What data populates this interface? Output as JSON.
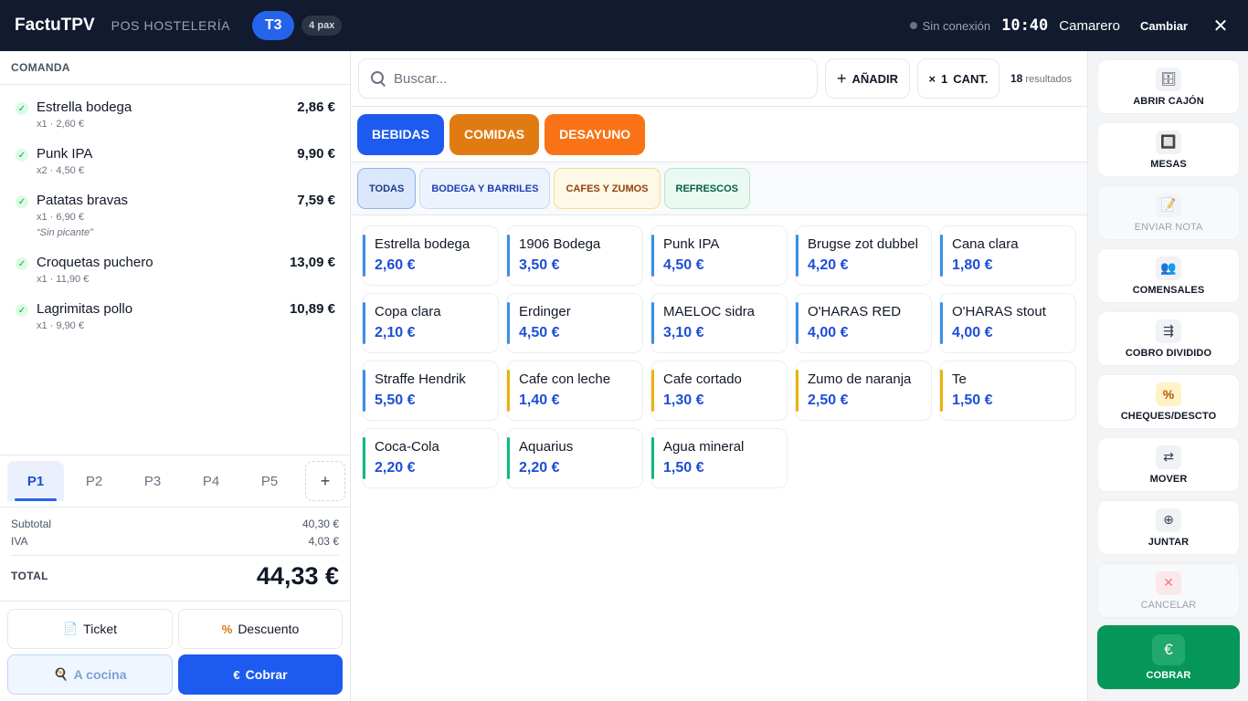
{
  "header": {
    "brand": "FactuTPV",
    "subtitle": "POS HOSTELERÍA",
    "table": "T3",
    "pax": "4 pax",
    "connection": "Sin conexión",
    "clock": "10:40",
    "waiter": "Camarero",
    "change": "Cambiar",
    "close": "✕"
  },
  "order": {
    "title": "COMANDA",
    "items": [
      {
        "name": "Estrella bodega",
        "total": "2,86 €",
        "meta": "x1 · 2,60 €",
        "note": ""
      },
      {
        "name": "Punk IPA",
        "total": "9,90 €",
        "meta": "x2 · 4,50 €",
        "note": ""
      },
      {
        "name": "Patatas bravas",
        "total": "7,59 €",
        "meta": "x1 · 6,90 €",
        "note": "“Sin picante”"
      },
      {
        "name": "Croquetas puchero",
        "total": "13,09 €",
        "meta": "x1 · 11,90 €",
        "note": ""
      },
      {
        "name": "Lagrimitas pollo",
        "total": "10,89 €",
        "meta": "x1 · 9,90 €",
        "note": ""
      }
    ]
  },
  "persons": [
    "P1",
    "P2",
    "P3",
    "P4",
    "P5"
  ],
  "persons_add": "+",
  "totals": {
    "subtotal_label": "Subtotal",
    "subtotal": "40,30 €",
    "tax_label": "IVA",
    "tax": "4,03 €",
    "total_label": "TOTAL",
    "total": "44,33 €"
  },
  "actions": {
    "ticket": "Ticket",
    "discount": "Descuento",
    "kitchen": "A cocina",
    "pay": "Cobrar",
    "pay_symbol": "€"
  },
  "search": {
    "placeholder": "Buscar...",
    "add": "AÑADIR",
    "qty_prefix": "×",
    "qty": "1",
    "qty_label": "CANT.",
    "results_count": "18",
    "results_label": "resultados"
  },
  "categories": [
    {
      "label": "BEBIDAS",
      "color": "#1d5bf0"
    },
    {
      "label": "COMIDAS",
      "color": "#e07b12"
    },
    {
      "label": "DESAYUNO",
      "color": "#f97316"
    }
  ],
  "subcategories": [
    {
      "label": "TODAS",
      "bg": "#dbe7fb",
      "border": "#8fb1ec",
      "text": "#1e3a8a"
    },
    {
      "label": "BODEGA Y BARRILES",
      "bg": "#edf3fd",
      "border": "#c9daf5",
      "text": "#1e40af"
    },
    {
      "label": "CAFES Y ZUMOS",
      "bg": "#fef8e6",
      "border": "#f4dc8f",
      "text": "#92400e"
    },
    {
      "label": "REFRESCOS",
      "bg": "#eaf9f2",
      "border": "#b5e6cd",
      "text": "#065f46"
    }
  ],
  "products": [
    {
      "name": "Estrella bodega",
      "price": "2,60 €",
      "color": "#3b8ee6"
    },
    {
      "name": "1906 Bodega",
      "price": "3,50 €",
      "color": "#3b8ee6"
    },
    {
      "name": "Punk IPA",
      "price": "4,50 €",
      "color": "#3b8ee6"
    },
    {
      "name": "Brugse zot dubbel",
      "price": "4,20 €",
      "color": "#3b8ee6"
    },
    {
      "name": "Cana clara",
      "price": "1,80 €",
      "color": "#3b8ee6"
    },
    {
      "name": "Copa clara",
      "price": "2,10 €",
      "color": "#3b8ee6"
    },
    {
      "name": "Erdinger",
      "price": "4,50 €",
      "color": "#3b8ee6"
    },
    {
      "name": "MAELOC sidra",
      "price": "3,10 €",
      "color": "#3b8ee6"
    },
    {
      "name": "O'HARAS RED",
      "price": "4,00 €",
      "color": "#3b8ee6"
    },
    {
      "name": "O'HARAS stout",
      "price": "4,00 €",
      "color": "#3b8ee6"
    },
    {
      "name": "Straffe Hendrik",
      "price": "5,50 €",
      "color": "#3b8ee6"
    },
    {
      "name": "Cafe con leche",
      "price": "1,40 €",
      "color": "#eab308"
    },
    {
      "name": "Cafe cortado",
      "price": "1,30 €",
      "color": "#eab308"
    },
    {
      "name": "Zumo de naranja",
      "price": "2,50 €",
      "color": "#eab308"
    },
    {
      "name": "Te",
      "price": "1,50 €",
      "color": "#eab308"
    },
    {
      "name": "Coca-Cola",
      "price": "2,20 €",
      "color": "#10b981"
    },
    {
      "name": "Aquarius",
      "price": "2,20 €",
      "color": "#10b981"
    },
    {
      "name": "Agua mineral",
      "price": "1,50 €",
      "color": "#10b981"
    }
  ],
  "side_actions": [
    {
      "label": "ABRIR CAJÓN",
      "icon": "cash-drawer-icon",
      "glyph": "🗄",
      "state": "normal"
    },
    {
      "label": "MESAS",
      "icon": "tables-icon",
      "glyph": "🔲",
      "state": "normal"
    },
    {
      "label": "ENVIAR NOTA",
      "icon": "note-icon",
      "glyph": "📝",
      "state": "disabled"
    },
    {
      "label": "COMENSALES",
      "icon": "diners-icon",
      "glyph": "👥",
      "state": "normal"
    },
    {
      "label": "COBRO DIVIDIDO",
      "icon": "split-icon",
      "glyph": "⇶",
      "state": "normal"
    },
    {
      "label": "CHEQUES/DESCTO",
      "icon": "percent-icon",
      "glyph": "%",
      "state": "yellow"
    },
    {
      "label": "MOVER",
      "icon": "swap-icon",
      "glyph": "⇄",
      "state": "normal"
    },
    {
      "label": "JUNTAR",
      "icon": "merge-icon",
      "glyph": "⊕",
      "state": "normal"
    },
    {
      "label": "CANCELAR",
      "icon": "cancel-icon",
      "glyph": "✕",
      "state": "danger"
    },
    {
      "label": "COBRAR",
      "icon": "euro-icon",
      "glyph": "€",
      "state": "pay"
    }
  ]
}
